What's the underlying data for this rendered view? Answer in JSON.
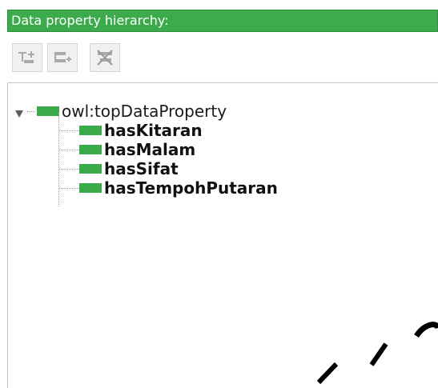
{
  "panel": {
    "title": "Data property hierarchy:",
    "header_color": "#3cab4c"
  },
  "toolbar": {
    "buttons": [
      {
        "name": "add-subproperty",
        "icon": "add-subproperty-icon"
      },
      {
        "name": "add-sibling-property",
        "icon": "add-sibling-property-icon"
      },
      {
        "name": "delete-property",
        "icon": "delete-property-icon"
      }
    ]
  },
  "tree": {
    "root": {
      "label": "owl:topDataProperty",
      "expanded": true,
      "icon": "data-property-icon"
    },
    "children": [
      {
        "label": "hasKitaran"
      },
      {
        "label": "hasMalam"
      },
      {
        "label": "hasSifat"
      },
      {
        "label": "hasTempohPutaran"
      }
    ],
    "property_color": "#3bab4a"
  }
}
